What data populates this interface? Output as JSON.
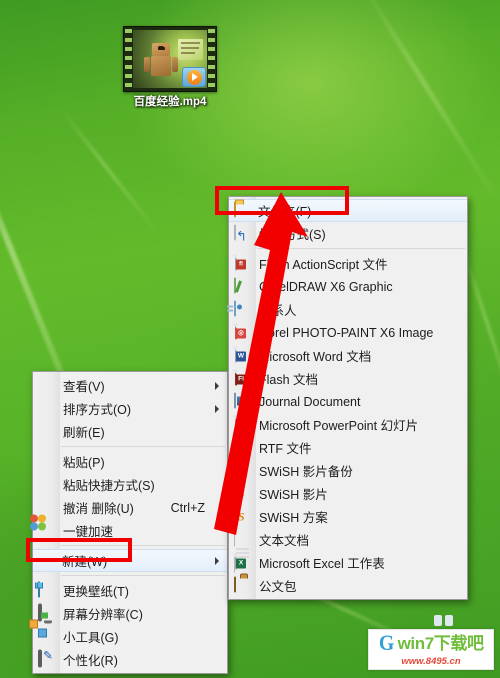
{
  "desktop": {
    "icon": {
      "label": "百度经验.mp4",
      "type": "video-thumbnail"
    },
    "wallpaper": "green-leaf"
  },
  "context_menu": {
    "items": [
      {
        "label": "查看(V)",
        "icon": "",
        "submenu": true,
        "accel": "",
        "separator_after": false
      },
      {
        "label": "排序方式(O)",
        "icon": "",
        "submenu": true,
        "accel": "",
        "separator_after": false
      },
      {
        "label": "刷新(E)",
        "icon": "",
        "submenu": false,
        "accel": "",
        "separator_after": true
      },
      {
        "label": "粘贴(P)",
        "icon": "",
        "submenu": false,
        "accel": "",
        "separator_after": false
      },
      {
        "label": "粘贴快捷方式(S)",
        "icon": "",
        "submenu": false,
        "accel": "",
        "separator_after": false
      },
      {
        "label": "撤消 删除(U)",
        "icon": "",
        "submenu": false,
        "accel": "Ctrl+Z",
        "separator_after": false
      },
      {
        "label": "一键加速",
        "icon": "speed-icon",
        "submenu": false,
        "accel": "",
        "separator_after": true
      },
      {
        "label": "新建(W)",
        "icon": "",
        "submenu": true,
        "accel": "",
        "separator_after": true,
        "selected": true
      },
      {
        "label": "更换壁纸(T)",
        "icon": "tshirt-icon",
        "submenu": false,
        "accel": "",
        "separator_after": false
      },
      {
        "label": "屏幕分辨率(C)",
        "icon": "monitor-icon",
        "submenu": false,
        "accel": "",
        "separator_after": false
      },
      {
        "label": "小工具(G)",
        "icon": "gadget-icon",
        "submenu": false,
        "accel": "",
        "separator_after": false
      },
      {
        "label": "个性化(R)",
        "icon": "personalize-icon",
        "submenu": false,
        "accel": "",
        "separator_after": false
      }
    ]
  },
  "new_submenu": {
    "items": [
      {
        "label": "文件夹(F)",
        "icon": "folder-icon",
        "separator_after": false,
        "selected": true
      },
      {
        "label": "快捷方式(S)",
        "icon": "shortcut-icon",
        "separator_after": true
      },
      {
        "label": "Flash ActionScript 文件",
        "icon": "flash-as-icon",
        "separator_after": false
      },
      {
        "label": "CorelDRAW X6 Graphic",
        "icon": "coreldraw-icon",
        "separator_after": false
      },
      {
        "label": "联系人",
        "icon": "contact-icon",
        "separator_after": false
      },
      {
        "label": "Corel PHOTO-PAINT X6 Image",
        "icon": "corel-photo-icon",
        "separator_after": false
      },
      {
        "label": "Microsoft Word 文档",
        "icon": "word-icon",
        "separator_after": false
      },
      {
        "label": "Flash 文档",
        "icon": "flash-icon",
        "separator_after": false
      },
      {
        "label": "Journal Document",
        "icon": "journal-icon",
        "separator_after": false
      },
      {
        "label": "Microsoft PowerPoint 幻灯片",
        "icon": "powerpoint-icon",
        "separator_after": false
      },
      {
        "label": "RTF 文件",
        "icon": "rtf-icon",
        "separator_after": false
      },
      {
        "label": "SWiSH 影片备份",
        "icon": "swish-icon",
        "separator_after": false
      },
      {
        "label": "SWiSH 影片",
        "icon": "swish-icon",
        "separator_after": false
      },
      {
        "label": "SWiSH 方案",
        "icon": "swish-icon",
        "separator_after": false
      },
      {
        "label": "文本文档",
        "icon": "textdoc-icon",
        "separator_after": false
      },
      {
        "label": "Microsoft Excel 工作表",
        "icon": "excel-icon",
        "separator_after": false
      },
      {
        "label": "公文包",
        "icon": "briefcase-icon",
        "separator_after": false
      }
    ]
  },
  "annotations": {
    "highlight_color": "#f00000",
    "arrow_label": "red-arrow-pointing-to-folder",
    "boxed_items": [
      "新建(W)",
      "文件夹(F)"
    ]
  },
  "watermark": {
    "logo_glyph": "G",
    "name": "win7下载吧",
    "url": "www.8495.cn"
  }
}
